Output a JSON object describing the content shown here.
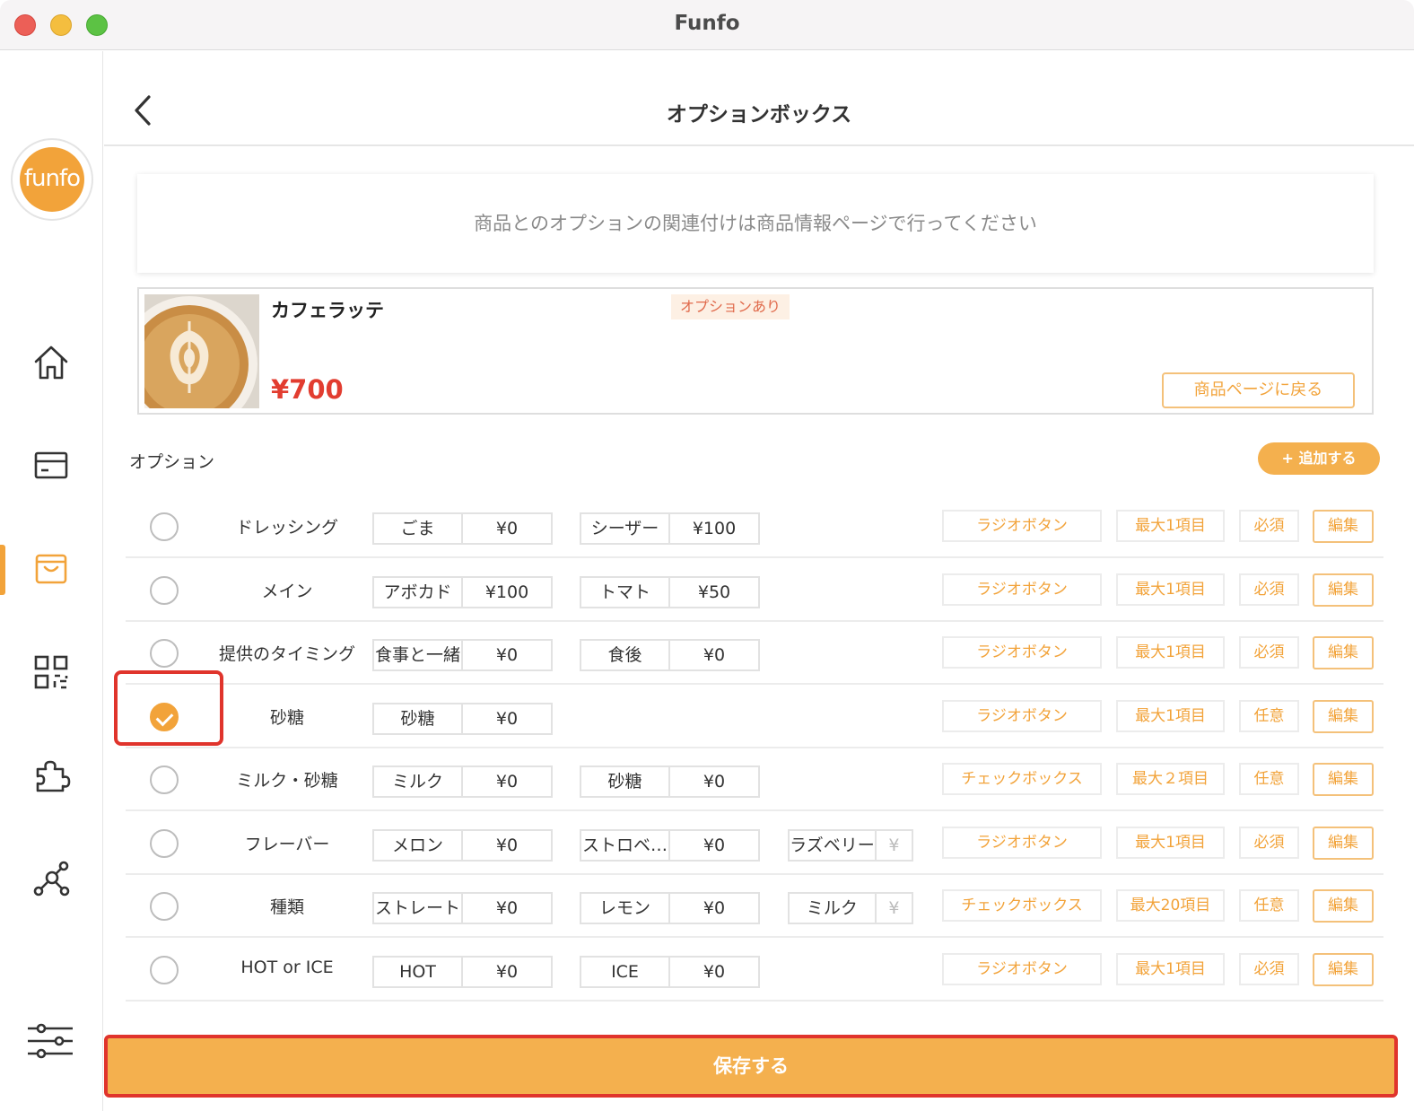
{
  "window": {
    "title": "Funfo"
  },
  "sidebar": {
    "logo_text": "funfo",
    "items": [
      {
        "icon": "home-icon"
      },
      {
        "icon": "card-icon"
      },
      {
        "icon": "shopping-bag-icon",
        "active": true
      },
      {
        "icon": "qr-code-icon"
      },
      {
        "icon": "puzzle-icon"
      },
      {
        "icon": "network-icon"
      },
      {
        "icon": "sliders-icon"
      }
    ]
  },
  "header": {
    "title": "オプションボックス"
  },
  "notice": {
    "text": "商品とのオプションの関連付けは商品情報ページで行ってください"
  },
  "product": {
    "name": "カフェラッテ",
    "badge": "オプションあり",
    "price": "¥700",
    "back_button": "商品ページに戻る"
  },
  "options": {
    "heading": "オプション",
    "add_button": "+ 追加する",
    "rows": [
      {
        "name": "ドレッシング",
        "checked": false,
        "choices": [
          {
            "name": "ごま",
            "price": "¥0"
          },
          {
            "name": "シーザー",
            "price": "¥100"
          }
        ],
        "type": "ラジオボタン",
        "max": "最大1項目",
        "required": "必須",
        "edit": "編集"
      },
      {
        "name": "メイン",
        "checked": false,
        "choices": [
          {
            "name": "アボカド",
            "price": "¥100"
          },
          {
            "name": "トマト",
            "price": "¥50"
          }
        ],
        "type": "ラジオボタン",
        "max": "最大1項目",
        "required": "必須",
        "edit": "編集"
      },
      {
        "name": "提供のタイミング",
        "checked": false,
        "choices": [
          {
            "name": "食事と一緒",
            "price": "¥0"
          },
          {
            "name": "食後",
            "price": "¥0"
          }
        ],
        "type": "ラジオボタン",
        "max": "最大1項目",
        "required": "必須",
        "edit": "編集"
      },
      {
        "name": "砂糖",
        "checked": true,
        "choices": [
          {
            "name": "砂糖",
            "price": "¥0"
          }
        ],
        "type": "ラジオボタン",
        "max": "最大1項目",
        "required": "任意",
        "edit": "編集"
      },
      {
        "name": "ミルク・砂糖",
        "checked": false,
        "choices": [
          {
            "name": "ミルク",
            "price": "¥0"
          },
          {
            "name": "砂糖",
            "price": "¥0"
          }
        ],
        "type": "チェックボックス",
        "max": "最大２項目",
        "required": "任意",
        "edit": "編集"
      },
      {
        "name": "フレーバー",
        "checked": false,
        "choices": [
          {
            "name": "メロン",
            "price": "¥0"
          },
          {
            "name": "ストロベ…",
            "price": "¥0"
          },
          {
            "name": "ラズベリー",
            "price": "¥"
          }
        ],
        "type": "ラジオボタン",
        "max": "最大1項目",
        "required": "必須",
        "edit": "編集"
      },
      {
        "name": "種類",
        "checked": false,
        "choices": [
          {
            "name": "ストレート",
            "price": "¥0"
          },
          {
            "name": "レモン",
            "price": "¥0"
          },
          {
            "name": "ミルク",
            "price": "¥"
          }
        ],
        "type": "チェックボックス",
        "max": "最大20項目",
        "required": "任意",
        "edit": "編集"
      },
      {
        "name": "HOT or ICE",
        "checked": false,
        "choices": [
          {
            "name": "HOT",
            "price": "¥0"
          },
          {
            "name": "ICE",
            "price": "¥0"
          }
        ],
        "type": "ラジオボタン",
        "max": "最大1項目",
        "required": "必須",
        "edit": "編集"
      }
    ]
  },
  "footer": {
    "save_button": "保存する"
  },
  "colors": {
    "accent": "#f2a33a",
    "price": "#e23d30",
    "highlight": "#e0342c"
  }
}
